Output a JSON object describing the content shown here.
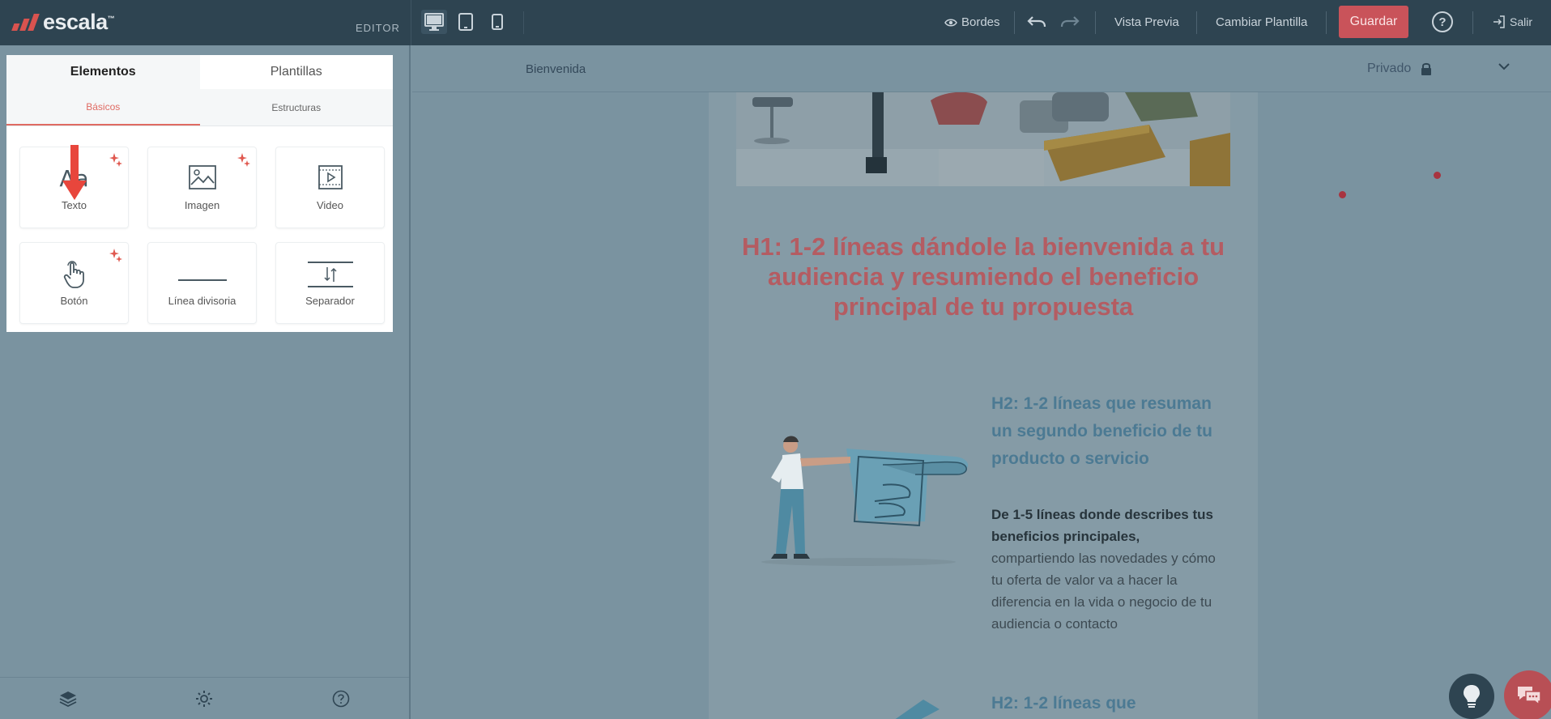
{
  "app": {
    "brand": "escala",
    "brand_mark": "™",
    "editor_label": "EDITOR"
  },
  "topbar": {
    "device_buttons": [
      {
        "icon": "desktop-icon",
        "active": true
      },
      {
        "icon": "tablet-icon",
        "active": false
      },
      {
        "icon": "mobile-icon",
        "active": false
      }
    ],
    "borders_label": "Bordes",
    "preview_label": "Vista Previa",
    "change_template_label": "Cambiar Plantilla",
    "save_label": "Guardar",
    "help_symbol": "?",
    "exit_label": "Salir"
  },
  "left_panel": {
    "tabs": [
      "Elementos",
      "Plantillas"
    ],
    "sub_tabs": [
      "Básicos",
      "Estructuras"
    ],
    "tiles": [
      {
        "label": "Texto",
        "icon": "text-aa-icon",
        "glyph": "Aa",
        "featured": true
      },
      {
        "label": "Imagen",
        "icon": "image-icon",
        "featured": true
      },
      {
        "label": "Video",
        "icon": "video-icon",
        "featured": false
      },
      {
        "label": "Botón",
        "icon": "pointer-hand-icon",
        "featured": true
      },
      {
        "label": "Línea divisoria",
        "icon": "divider-line-icon",
        "featured": false
      },
      {
        "label": "Separador",
        "icon": "spacer-icon",
        "featured": false
      }
    ],
    "bottom_icons": [
      "layers-icon",
      "settings-gear-icon",
      "help-circle-icon"
    ]
  },
  "page_bar": {
    "page_name": "Bienvenida",
    "privacy_label": "Privado"
  },
  "canvas": {
    "h1": "H1: 1-2 líneas dándole la bienvenida a tu audiencia y resumiendo el beneficio principal de tu propuesta",
    "h2_first": "H2: 1-2 líneas que resuman un segundo beneficio de tu producto o servicio",
    "body_bold": "De 1-5 líneas donde describes tus beneficios principales,",
    "body_rest": " compartiendo las novedades y cómo tu oferta de valor va a hacer la diferencia en la vida o negocio de tu audiencia o contacto",
    "h2_second": "H2: 1-2 líneas que"
  },
  "colors": {
    "topbar": "#2e4451",
    "accent_red": "#c9535a",
    "h1_color": "#b45c62",
    "h2_color": "#4c7a93",
    "overlay": "#7a93a0"
  }
}
